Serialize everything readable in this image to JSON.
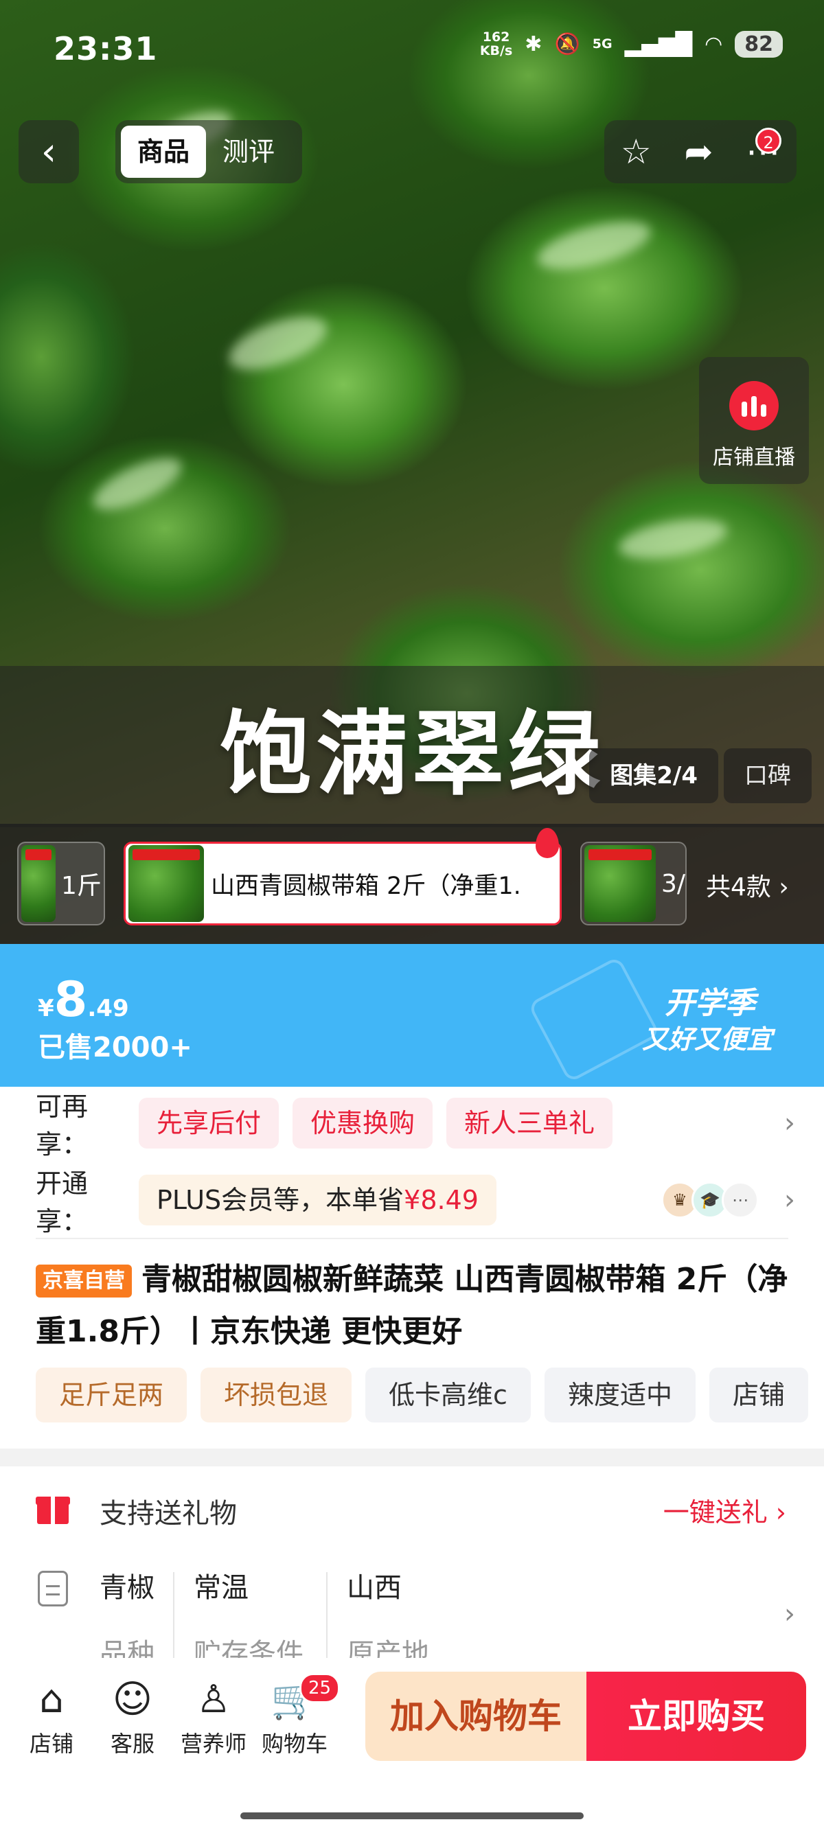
{
  "status": {
    "time": "23:31",
    "net_speed": "162",
    "net_unit": "KB/s",
    "sig_label": "5G",
    "battery": "82"
  },
  "header": {
    "back_glyph": "‹",
    "tabs": [
      "商品",
      "测评"
    ],
    "more_badge": "2"
  },
  "live": {
    "label": "店铺直播"
  },
  "hero": {
    "headline": "饱满翠绿",
    "gallery_label": "图集2/4",
    "reviews_label": "口碑"
  },
  "variants": {
    "items": [
      {
        "label": "1斤"
      },
      {
        "label": "山西青圆椒带箱 2斤（净重1."
      },
      {
        "label": "3/"
      }
    ],
    "count_label": "共4款 ›"
  },
  "price": {
    "currency": "¥",
    "integer": "8",
    "decimal": ".49",
    "sold": "已售2000+"
  },
  "promo": {
    "line1": "开学季",
    "line2": "又好又便宜"
  },
  "benefits": {
    "label": "可再享：",
    "chips": [
      "先享后付",
      "优惠换购",
      "新人三单礼"
    ]
  },
  "membership": {
    "label": "开通享：",
    "chip_text": "PLUS会员等，本单省",
    "saving": "¥8.49",
    "icons": [
      "crown-icon",
      "graduation-cap-icon",
      "more-icon"
    ]
  },
  "product": {
    "badge": "京喜自营",
    "title": "青椒甜椒圆椒新鲜蔬菜 山西青圆椒带箱 2斤（净重1.8斤）丨京东快递 更快更好",
    "tags": [
      "足斤足两",
      "坏损包退",
      "低卡高维c",
      "辣度适中",
      "店铺"
    ]
  },
  "gift": {
    "label": "支持送礼物",
    "action": "一键送礼 ›"
  },
  "specs": [
    {
      "value": "青椒",
      "key": "品种"
    },
    {
      "value": "常温",
      "key": "贮存条件"
    },
    {
      "value": "山西",
      "key": "原产地"
    }
  ],
  "bottom_nav": {
    "items": [
      {
        "label": "店铺",
        "icon": "store-icon"
      },
      {
        "label": "客服",
        "icon": "customer-service-icon"
      },
      {
        "label": "营养师",
        "icon": "nutritionist-icon"
      },
      {
        "label": "购物车",
        "icon": "cart-icon"
      }
    ],
    "cart_badge": "25",
    "add_to_cart": "加入购物车",
    "buy_now": "立即购买"
  },
  "colors": {
    "accent_red": "#f0243a",
    "price_blue": "#41b6f7",
    "cart_orange": "#fde4c8"
  }
}
